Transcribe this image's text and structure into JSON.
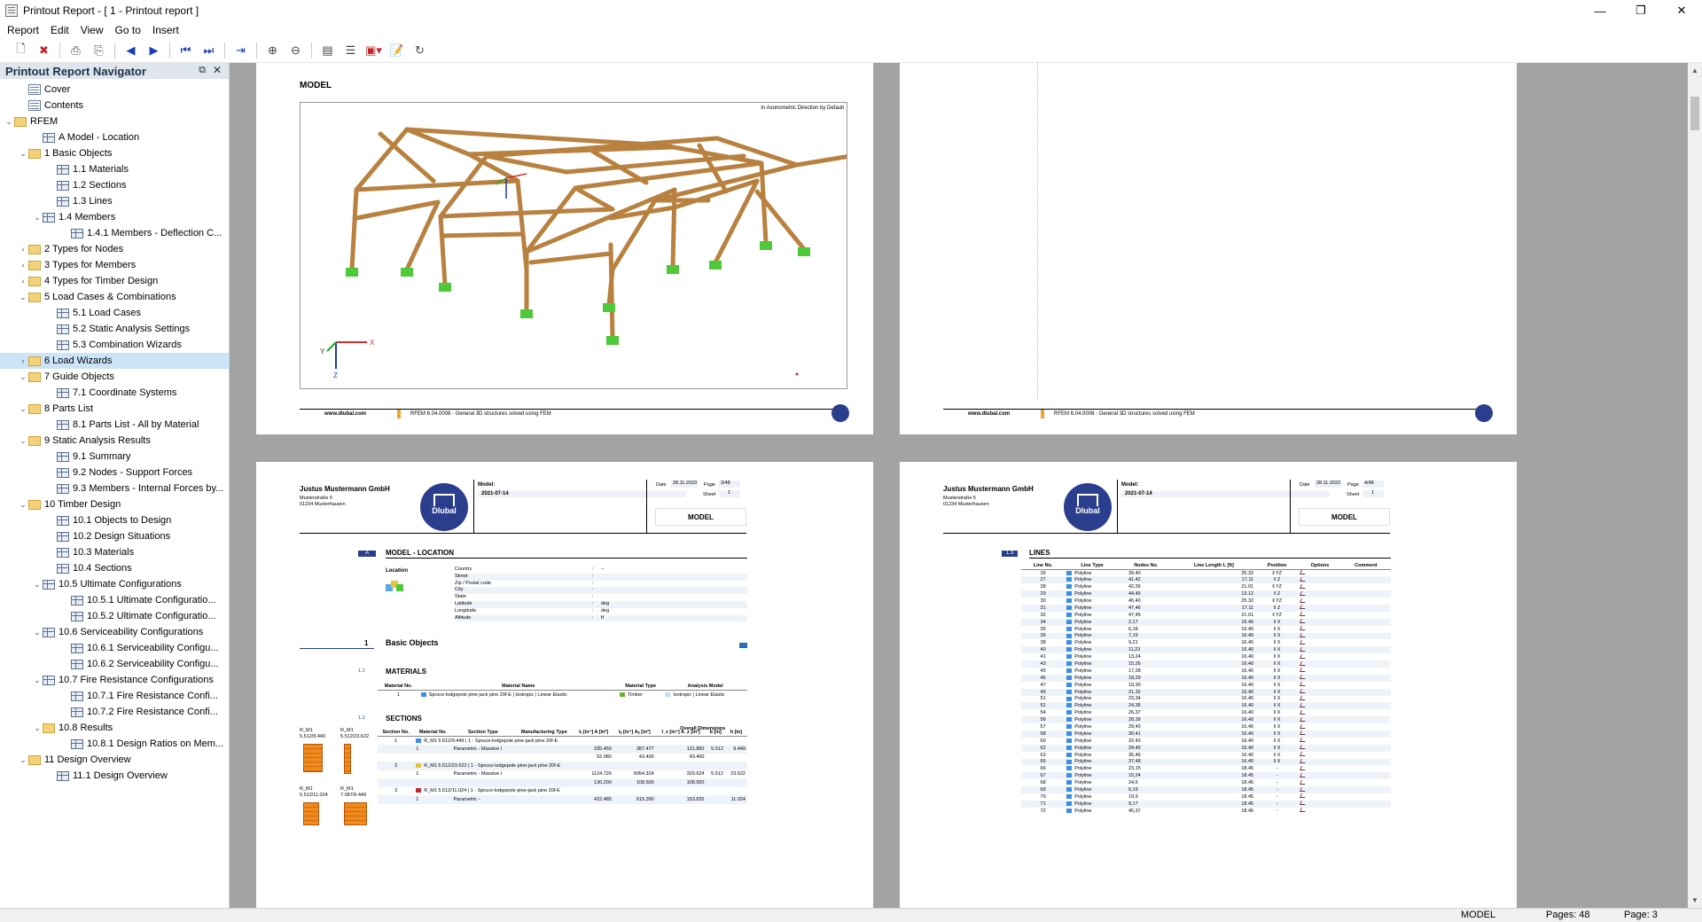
{
  "window": {
    "title": "Printout Report - [ 1 - Printout report ]",
    "controls": [
      "—",
      "❐",
      "✕"
    ]
  },
  "menu": [
    "Report",
    "Edit",
    "View",
    "Go to",
    "Insert"
  ],
  "toolbar": {
    "icons": [
      "new-icon",
      "delete-icon",
      "print-icon",
      "print-preview-icon",
      "previous-page-icon",
      "next-page-icon",
      "first-page-icon",
      "last-page-icon",
      "export-icon",
      "zoom-in-icon",
      "zoom-out-icon",
      "page-layout-icon",
      "header-footer-icon",
      "template-icon",
      "properties-icon",
      "refresh-icon"
    ]
  },
  "navigator": {
    "title": "Printout Report Navigator",
    "items": [
      {
        "label": "Cover",
        "level": 1,
        "icon": "doc",
        "toggle": ""
      },
      {
        "label": "Contents",
        "level": 1,
        "icon": "doc",
        "toggle": ""
      },
      {
        "label": "RFEM",
        "level": 0,
        "icon": "folder",
        "toggle": "v"
      },
      {
        "label": "A Model - Location",
        "level": 2,
        "icon": "table",
        "toggle": ""
      },
      {
        "label": "1 Basic Objects",
        "level": 1,
        "icon": "folder",
        "toggle": "v"
      },
      {
        "label": "1.1 Materials",
        "level": 3,
        "icon": "table",
        "toggle": ""
      },
      {
        "label": "1.2 Sections",
        "level": 3,
        "icon": "table",
        "toggle": ""
      },
      {
        "label": "1.3 Lines",
        "level": 3,
        "icon": "table",
        "toggle": ""
      },
      {
        "label": "1.4 Members",
        "level": 2,
        "icon": "table",
        "toggle": "v"
      },
      {
        "label": "1.4.1 Members - Deflection C...",
        "level": 4,
        "icon": "table",
        "toggle": ""
      },
      {
        "label": "2 Types for Nodes",
        "level": 1,
        "icon": "folder",
        "toggle": ">"
      },
      {
        "label": "3 Types for Members",
        "level": 1,
        "icon": "folder",
        "toggle": ">"
      },
      {
        "label": "4 Types for Timber Design",
        "level": 1,
        "icon": "folder",
        "toggle": ">"
      },
      {
        "label": "5 Load Cases & Combinations",
        "level": 1,
        "icon": "folder",
        "toggle": "v"
      },
      {
        "label": "5.1 Load Cases",
        "level": 3,
        "icon": "table",
        "toggle": ""
      },
      {
        "label": "5.2 Static Analysis Settings",
        "level": 3,
        "icon": "table",
        "toggle": ""
      },
      {
        "label": "5.3 Combination Wizards",
        "level": 3,
        "icon": "table",
        "toggle": ""
      },
      {
        "label": "6 Load Wizards",
        "level": 1,
        "icon": "folder",
        "toggle": ">",
        "selected": true
      },
      {
        "label": "7 Guide Objects",
        "level": 1,
        "icon": "folder",
        "toggle": "v"
      },
      {
        "label": "7.1 Coordinate Systems",
        "level": 3,
        "icon": "table",
        "toggle": ""
      },
      {
        "label": "8 Parts List",
        "level": 1,
        "icon": "folder",
        "toggle": "v"
      },
      {
        "label": "8.1 Parts List - All by Material",
        "level": 3,
        "icon": "table",
        "toggle": ""
      },
      {
        "label": "9 Static Analysis Results",
        "level": 1,
        "icon": "folder",
        "toggle": "v"
      },
      {
        "label": "9.1 Summary",
        "level": 3,
        "icon": "table",
        "toggle": ""
      },
      {
        "label": "9.2 Nodes - Support Forces",
        "level": 3,
        "icon": "table",
        "toggle": ""
      },
      {
        "label": "9.3 Members - Internal Forces by...",
        "level": 3,
        "icon": "table",
        "toggle": ""
      },
      {
        "label": "10 Timber Design",
        "level": 1,
        "icon": "folder",
        "toggle": "v"
      },
      {
        "label": "10.1 Objects to Design",
        "level": 3,
        "icon": "table",
        "toggle": ""
      },
      {
        "label": "10.2 Design Situations",
        "level": 3,
        "icon": "table",
        "toggle": ""
      },
      {
        "label": "10.3 Materials",
        "level": 3,
        "icon": "table",
        "toggle": ""
      },
      {
        "label": "10.4 Sections",
        "level": 3,
        "icon": "table",
        "toggle": ""
      },
      {
        "label": "10.5 Ultimate Configurations",
        "level": 2,
        "icon": "table",
        "toggle": "v"
      },
      {
        "label": "10.5.1 Ultimate Configuratio...",
        "level": 4,
        "icon": "table",
        "toggle": ""
      },
      {
        "label": "10.5.2 Ultimate Configuratio...",
        "level": 4,
        "icon": "table",
        "toggle": ""
      },
      {
        "label": "10.6 Serviceability Configurations",
        "level": 2,
        "icon": "table",
        "toggle": "v"
      },
      {
        "label": "10.6.1 Serviceability Configu...",
        "level": 4,
        "icon": "table",
        "toggle": ""
      },
      {
        "label": "10.6.2 Serviceability Configu...",
        "level": 4,
        "icon": "table",
        "toggle": ""
      },
      {
        "label": "10.7 Fire Resistance Configurations",
        "level": 2,
        "icon": "table",
        "toggle": "v"
      },
      {
        "label": "10.7.1 Fire Resistance Confi...",
        "level": 4,
        "icon": "table",
        "toggle": ""
      },
      {
        "label": "10.7.2 Fire Resistance Confi...",
        "level": 4,
        "icon": "table",
        "toggle": ""
      },
      {
        "label": "10.8 Results",
        "level": 2,
        "icon": "folder",
        "toggle": "v"
      },
      {
        "label": "10.8.1 Design Ratios on Mem...",
        "level": 4,
        "icon": "table",
        "toggle": ""
      },
      {
        "label": "11 Design Overview",
        "level": 1,
        "icon": "folder",
        "toggle": "v"
      },
      {
        "label": "11.1 Design Overview",
        "level": 3,
        "icon": "table",
        "toggle": ""
      }
    ]
  },
  "page_model": {
    "heading": "MODEL",
    "view_caption": "In Axonometric Direction by Default",
    "footer_url": "www.dlubal.com",
    "footer_text": "RFEM 6.04.0008 - General 3D structures solved using FEM",
    "axes": {
      "x": "X",
      "y": "Y",
      "z": "Z"
    }
  },
  "page_header": {
    "company": "Justus Mustermann GmbH",
    "street": "Musterstraße 5",
    "city": "01234 Musterhausen",
    "logo": "Dlubal",
    "model_label": "Model:",
    "model_value": "2021-07-14",
    "date_label": "Date",
    "date_value": "28.11.2023",
    "page_label": "Page",
    "sheet_label": "Sheet",
    "sheet_value": "1",
    "section": "MODEL",
    "left_page": "3/48",
    "right_page": "4/48"
  },
  "left_page": {
    "a_num": "A",
    "a_title": "MODEL - LOCATION",
    "location_label": "Location",
    "location_rows": [
      {
        "k": "Country",
        "v": "--"
      },
      {
        "k": "Street",
        "v": ""
      },
      {
        "k": "Zip / Postal code",
        "v": ""
      },
      {
        "k": "City",
        "v": ""
      },
      {
        "k": "State",
        "v": ""
      },
      {
        "k": "Latitude",
        "v": "deg"
      },
      {
        "k": "Longitude",
        "v": "deg"
      },
      {
        "k": "Altitude",
        "v": "ft"
      }
    ],
    "basic_num": "1",
    "basic_title": "Basic Objects",
    "mat_num": "1.1",
    "mat_title": "MATERIALS",
    "mat_headers": [
      "Material No.",
      "Material Name",
      "Material Type",
      "Analysis Model"
    ],
    "mat_row": [
      "1",
      "Spruce-lodgepole pine-jack pine 20f-E | Isotropic | Linear Elastic",
      "Timber",
      "Isotropic | Linear Elastic"
    ],
    "sec_num": "1.2",
    "sec_title": "SECTIONS",
    "sec_headers": [
      "Section No.",
      "Material No.",
      "Section Type",
      "Manufacturing Type",
      "Iₜ [in⁴] A [in²]",
      "Iᵧ [in⁴] Aᵧ [in²]",
      "I_z [in⁴] A_z [in²]",
      "b [in]",
      "h [in]"
    ],
    "sec_overall": "Overall Dimensions",
    "sec_rows": [
      {
        "no": "1",
        "name": "R_M1 5.512/9.449 | 1 - Spruce-lodgepole pine-jack pine 20f-E",
        "mat": "1",
        "type": "Parametric - Massive I",
        "v1": "335.450",
        "v2": "387.477",
        "v3": "131.850",
        "b": "5.512",
        "h": "9.449",
        "a1": "52.080",
        "a2": "43.400",
        "a3": "43.400"
      },
      {
        "no": "2",
        "name": "R_M1 5.512/23.622 | 1 - Spruce-lodgepole pine-jack pine 20f-E",
        "mat": "1",
        "type": "Parametric - Massive I",
        "v1": "1124.726",
        "v2": "6054.324",
        "v3": "329.624",
        "b": "5.512",
        "h": "23.622",
        "a1": "130.200",
        "a2": "108.500",
        "a3": "108.500"
      },
      {
        "no": "3",
        "name": "R_M1 5.512/11.024 | 1 - Spruce-lodgepole pine-jack pine 20f-E",
        "mat": "1",
        "type": "Parametric -",
        "v1": "422.485",
        "v2": "615.390",
        "v3": "153.825",
        "b": "",
        "h": "11.024",
        "a1": "",
        "a2": "",
        "a3": ""
      }
    ],
    "thumbs": [
      {
        "name": "R_M1",
        "dim": "5.512/9.449"
      },
      {
        "name": "R_M1",
        "dim": "5.512/23.622"
      },
      {
        "name": "R_M1",
        "dim": "5.512/11.024"
      },
      {
        "name": "R_M1",
        "dim": "7.087/9.449"
      }
    ]
  },
  "right_page": {
    "num": "1.3",
    "title": "LINES",
    "headers": [
      "Line No.",
      "Line Type",
      "Nodes No.",
      "Line Length L [ft]",
      "Position",
      "Options",
      "Comment"
    ],
    "rows": [
      [
        "26",
        "Polyline",
        "39,40",
        "25.32",
        "‖ YZ"
      ],
      [
        "27",
        "Polyline",
        "41,42",
        "17.11",
        "‖ Z"
      ],
      [
        "28",
        "Polyline",
        "42,39",
        "21.01",
        "‖ YZ"
      ],
      [
        "29",
        "Polyline",
        "44,45",
        "13.12",
        "‖ Z"
      ],
      [
        "30",
        "Polyline",
        "45,40",
        "25.32",
        "‖ YZ"
      ],
      [
        "31",
        "Polyline",
        "47,46",
        "17.11",
        "‖ Z"
      ],
      [
        "32",
        "Polyline",
        "47,45",
        "21.01",
        "‖ YZ"
      ],
      [
        "34",
        "Polyline",
        "2,17",
        "16.40",
        "‖ X"
      ],
      [
        "35",
        "Polyline",
        "6,18",
        "16.40",
        "‖ X"
      ],
      [
        "36",
        "Polyline",
        "7,19",
        "16.40",
        "‖ X"
      ],
      [
        "38",
        "Polyline",
        "9,21",
        "16.40",
        "‖ X"
      ],
      [
        "40",
        "Polyline",
        "11,23",
        "16.40",
        "‖ X"
      ],
      [
        "41",
        "Polyline",
        "13,24",
        "16.40",
        "‖ X"
      ],
      [
        "43",
        "Polyline",
        "15,26",
        "16.40",
        "‖ X"
      ],
      [
        "45",
        "Polyline",
        "17,28",
        "16.40",
        "‖ X"
      ],
      [
        "46",
        "Polyline",
        "18,29",
        "16.40",
        "‖ X"
      ],
      [
        "47",
        "Polyline",
        "19,30",
        "16.40",
        "‖ X"
      ],
      [
        "49",
        "Polyline",
        "21,32",
        "16.40",
        "‖ X"
      ],
      [
        "51",
        "Polyline",
        "23,34",
        "16.40",
        "‖ X"
      ],
      [
        "52",
        "Polyline",
        "24,35",
        "16.40",
        "‖ X"
      ],
      [
        "54",
        "Polyline",
        "26,37",
        "16.40",
        "‖ X"
      ],
      [
        "56",
        "Polyline",
        "28,39",
        "16.40",
        "‖ X"
      ],
      [
        "57",
        "Polyline",
        "29,40",
        "16.40",
        "‖ X"
      ],
      [
        "58",
        "Polyline",
        "30,41",
        "16.40",
        "‖ X"
      ],
      [
        "60",
        "Polyline",
        "32,43",
        "16.40",
        "‖ X"
      ],
      [
        "62",
        "Polyline",
        "34,45",
        "16.40",
        "‖ X"
      ],
      [
        "63",
        "Polyline",
        "35,46",
        "16.40",
        "‖ X"
      ],
      [
        "65",
        "Polyline",
        "37,48",
        "16.40",
        "‖ X"
      ],
      [
        "66",
        "Polyline",
        "23,15",
        "18.45",
        "-"
      ],
      [
        "67",
        "Polyline",
        "15,24",
        "18.45",
        "-"
      ],
      [
        "68",
        "Polyline",
        "24,6",
        "18.45",
        "-"
      ],
      [
        "69",
        "Polyline",
        "6,19",
        "18.45",
        "-"
      ],
      [
        "70",
        "Polyline",
        "19,9",
        "18.45",
        "-"
      ],
      [
        "71",
        "Polyline",
        "9,17",
        "18.45",
        "-"
      ],
      [
        "72",
        "Polyline",
        "45,37",
        "18.45",
        "-"
      ]
    ]
  },
  "status": {
    "section": "MODEL",
    "pages": "Pages: 48",
    "page": "Page: 3"
  },
  "colors": {
    "timber": "#b9813f",
    "support": "#4ec93a",
    "accent": "#2b3e8e",
    "viewport_bg": "#a3a3a3"
  }
}
